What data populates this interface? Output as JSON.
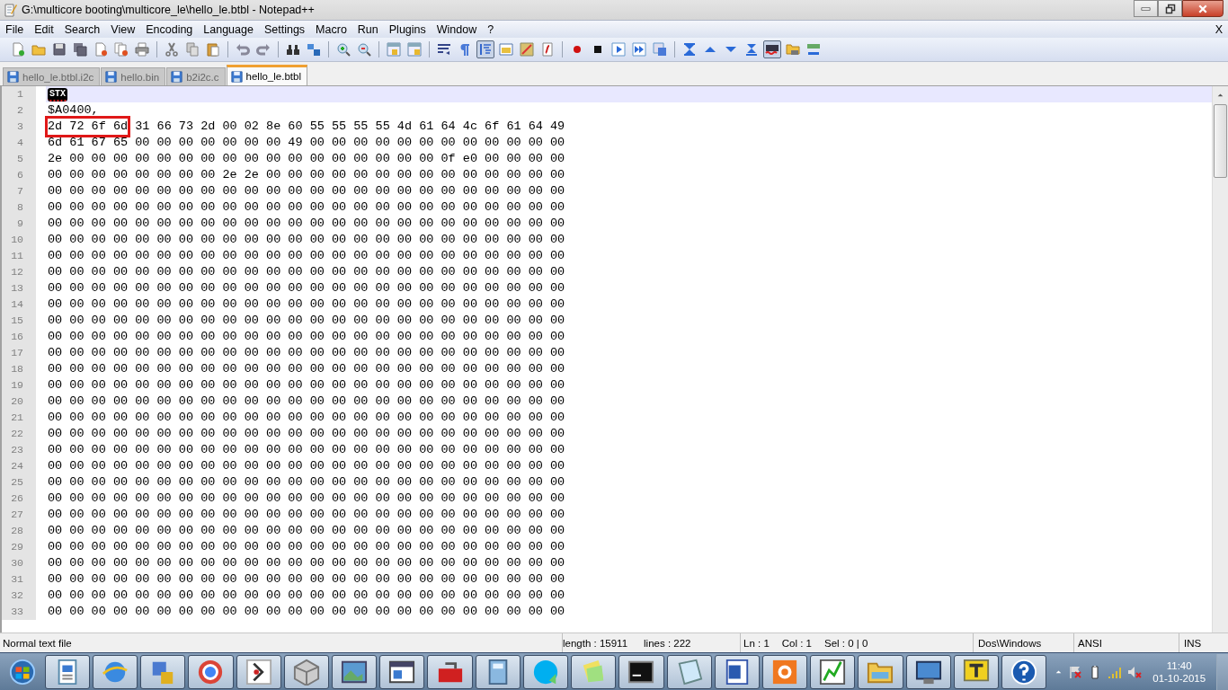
{
  "window": {
    "title": "G:\\multicore booting\\multicore_le\\hello_le.btbl - Notepad++"
  },
  "menu": [
    "File",
    "Edit",
    "Search",
    "View",
    "Encoding",
    "Language",
    "Settings",
    "Macro",
    "Run",
    "Plugins",
    "Window",
    "?"
  ],
  "menu_close": "X",
  "toolbar": [
    [
      {
        "pressed": false
      },
      {
        "pressed": false
      },
      {
        "pressed": false
      },
      {
        "pressed": false
      },
      {
        "pressed": false
      },
      {
        "pressed": false
      },
      {
        "pressed": false
      }
    ],
    [
      {
        "pressed": false
      },
      {
        "pressed": false
      },
      {
        "pressed": false
      }
    ],
    [
      {
        "pressed": false
      },
      {
        "pressed": false
      }
    ],
    [
      {
        "pressed": false
      },
      {
        "pressed": false
      }
    ],
    [
      {
        "pressed": false
      },
      {
        "pressed": false
      }
    ],
    [
      {
        "pressed": false
      },
      {
        "pressed": false
      }
    ],
    [
      {
        "pressed": false
      },
      {
        "pressed": false
      },
      {
        "pressed": true
      },
      {
        "pressed": false
      },
      {
        "pressed": false
      },
      {
        "pressed": false
      }
    ],
    [
      {
        "pressed": false
      },
      {
        "pressed": false
      },
      {
        "pressed": false
      },
      {
        "pressed": false
      },
      {
        "pressed": false
      }
    ],
    [
      {
        "pressed": false
      },
      {
        "pressed": false
      },
      {
        "pressed": false
      },
      {
        "pressed": false
      },
      {
        "pressed": true
      },
      {
        "pressed": false
      },
      {
        "pressed": false
      }
    ]
  ],
  "tabs": [
    {
      "label": "hello_le.btbl.i2c",
      "selected": false
    },
    {
      "label": "hello.bin",
      "selected": false
    },
    {
      "label": "b2i2c.c",
      "selected": false
    },
    {
      "label": "hello_le.btbl",
      "selected": true
    }
  ],
  "editor": {
    "lines": [
      {
        "number": "1",
        "current": true,
        "segments": [
          {
            "kind": "control",
            "text": "STX"
          }
        ]
      },
      {
        "number": "2",
        "current": false,
        "text": "$A0400,"
      },
      {
        "number": "3",
        "current": false,
        "segments": [
          {
            "kind": "boxed",
            "text": "2d 72 6f 6d"
          },
          {
            "kind": "plain",
            "text": " 31 66 73 2d 00 02 8e 60 55 55 55 55 4d 61 64 4c 6f 61 64 49"
          }
        ]
      },
      {
        "number": "4",
        "current": false,
        "text": "6d 61 67 65 00 00 00 00 00 00 00 49 00 00 00 00 00 00 00 00 00 00 00 00"
      },
      {
        "number": "5",
        "current": false,
        "text": "2e 00 00 00 00 00 00 00 00 00 00 00 00 00 00 00 00 00 0f e0 00 00 00 00"
      },
      {
        "number": "6",
        "current": false,
        "text": "00 00 00 00 00 00 00 00 2e 2e 00 00 00 00 00 00 00 00 00 00 00 00 00 00"
      },
      {
        "number": "7",
        "current": false,
        "text": "00 00 00 00 00 00 00 00 00 00 00 00 00 00 00 00 00 00 00 00 00 00 00 00"
      },
      {
        "number": "8",
        "current": false,
        "text": "00 00 00 00 00 00 00 00 00 00 00 00 00 00 00 00 00 00 00 00 00 00 00 00"
      },
      {
        "number": "9",
        "current": false,
        "text": "00 00 00 00 00 00 00 00 00 00 00 00 00 00 00 00 00 00 00 00 00 00 00 00"
      },
      {
        "number": "10",
        "current": false,
        "text": "00 00 00 00 00 00 00 00 00 00 00 00 00 00 00 00 00 00 00 00 00 00 00 00"
      },
      {
        "number": "11",
        "current": false,
        "text": "00 00 00 00 00 00 00 00 00 00 00 00 00 00 00 00 00 00 00 00 00 00 00 00"
      },
      {
        "number": "12",
        "current": false,
        "text": "00 00 00 00 00 00 00 00 00 00 00 00 00 00 00 00 00 00 00 00 00 00 00 00"
      },
      {
        "number": "13",
        "current": false,
        "text": "00 00 00 00 00 00 00 00 00 00 00 00 00 00 00 00 00 00 00 00 00 00 00 00"
      },
      {
        "number": "14",
        "current": false,
        "text": "00 00 00 00 00 00 00 00 00 00 00 00 00 00 00 00 00 00 00 00 00 00 00 00"
      },
      {
        "number": "15",
        "current": false,
        "text": "00 00 00 00 00 00 00 00 00 00 00 00 00 00 00 00 00 00 00 00 00 00 00 00"
      },
      {
        "number": "16",
        "current": false,
        "text": "00 00 00 00 00 00 00 00 00 00 00 00 00 00 00 00 00 00 00 00 00 00 00 00"
      },
      {
        "number": "17",
        "current": false,
        "text": "00 00 00 00 00 00 00 00 00 00 00 00 00 00 00 00 00 00 00 00 00 00 00 00"
      },
      {
        "number": "18",
        "current": false,
        "text": "00 00 00 00 00 00 00 00 00 00 00 00 00 00 00 00 00 00 00 00 00 00 00 00"
      },
      {
        "number": "19",
        "current": false,
        "text": "00 00 00 00 00 00 00 00 00 00 00 00 00 00 00 00 00 00 00 00 00 00 00 00"
      },
      {
        "number": "20",
        "current": false,
        "text": "00 00 00 00 00 00 00 00 00 00 00 00 00 00 00 00 00 00 00 00 00 00 00 00"
      },
      {
        "number": "21",
        "current": false,
        "text": "00 00 00 00 00 00 00 00 00 00 00 00 00 00 00 00 00 00 00 00 00 00 00 00"
      },
      {
        "number": "22",
        "current": false,
        "text": "00 00 00 00 00 00 00 00 00 00 00 00 00 00 00 00 00 00 00 00 00 00 00 00"
      },
      {
        "number": "23",
        "current": false,
        "text": "00 00 00 00 00 00 00 00 00 00 00 00 00 00 00 00 00 00 00 00 00 00 00 00"
      },
      {
        "number": "24",
        "current": false,
        "text": "00 00 00 00 00 00 00 00 00 00 00 00 00 00 00 00 00 00 00 00 00 00 00 00"
      },
      {
        "number": "25",
        "current": false,
        "text": "00 00 00 00 00 00 00 00 00 00 00 00 00 00 00 00 00 00 00 00 00 00 00 00"
      },
      {
        "number": "26",
        "current": false,
        "text": "00 00 00 00 00 00 00 00 00 00 00 00 00 00 00 00 00 00 00 00 00 00 00 00"
      },
      {
        "number": "27",
        "current": false,
        "text": "00 00 00 00 00 00 00 00 00 00 00 00 00 00 00 00 00 00 00 00 00 00 00 00"
      },
      {
        "number": "28",
        "current": false,
        "text": "00 00 00 00 00 00 00 00 00 00 00 00 00 00 00 00 00 00 00 00 00 00 00 00"
      },
      {
        "number": "29",
        "current": false,
        "text": "00 00 00 00 00 00 00 00 00 00 00 00 00 00 00 00 00 00 00 00 00 00 00 00"
      },
      {
        "number": "30",
        "current": false,
        "text": "00 00 00 00 00 00 00 00 00 00 00 00 00 00 00 00 00 00 00 00 00 00 00 00"
      },
      {
        "number": "31",
        "current": false,
        "text": "00 00 00 00 00 00 00 00 00 00 00 00 00 00 00 00 00 00 00 00 00 00 00 00"
      },
      {
        "number": "32",
        "current": false,
        "text": "00 00 00 00 00 00 00 00 00 00 00 00 00 00 00 00 00 00 00 00 00 00 00 00"
      },
      {
        "number": "33",
        "current": false,
        "text": "00 00 00 00 00 00 00 00 00 00 00 00 00 00 00 00 00 00 00 00 00 00 00 00"
      }
    ]
  },
  "status_bar": [
    "Normal text file",
    "length : 15911",
    "lines : 222",
    "Ln : 1",
    "Col : 1",
    "Sel : 0 | 0",
    "Dos\\Windows",
    "ANSI",
    "INS"
  ],
  "clock": {
    "time": "11:40",
    "date": "01-10-2015"
  }
}
